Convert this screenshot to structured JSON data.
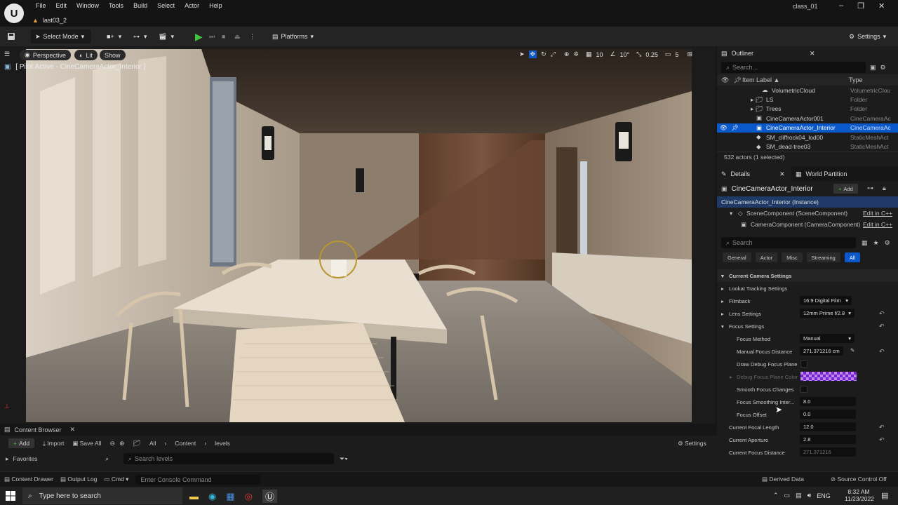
{
  "menubar": {
    "items": [
      "File",
      "Edit",
      "Window",
      "Tools",
      "Build",
      "Select",
      "Actor",
      "Help"
    ],
    "level_tab": "last03_2",
    "project": "class_01"
  },
  "toolbar": {
    "select_mode": "Select Mode",
    "platforms": "Platforms",
    "settings": "Settings"
  },
  "viewport": {
    "perspective": "Perspective",
    "lit": "Lit",
    "show": "Show",
    "pilot_label": "[ Pilot Active - CineCameraActor_Interior ]",
    "grid_value": "10",
    "angle_value": "10°",
    "scale_value": "0.25",
    "speed_value": "5"
  },
  "outliner": {
    "title": "Outliner",
    "search_placeholder": "Search...",
    "col_label": "Item Label ▲",
    "col_type": "Type",
    "rows": [
      {
        "name": "VolumetricCloud",
        "type": "VolumetricClou"
      },
      {
        "name": "LS",
        "type": "Folder"
      },
      {
        "name": "Trees",
        "type": "Folder"
      },
      {
        "name": "CineCameraActor001",
        "type": "CineCameraAc"
      },
      {
        "name": "CineCameraActor_Interior",
        "type": "CineCameraAc"
      },
      {
        "name": "SM_cliffrock04_lod00",
        "type": "StaticMeshAct"
      },
      {
        "name": "SM_dead-tree03",
        "type": "StaticMeshAct"
      }
    ],
    "count": "532 actors (1 selected)"
  },
  "details": {
    "tab": "Details",
    "tab2": "World Partition",
    "actor_name": "CineCameraActor_Interior",
    "add": "Add",
    "instance": "CineCameraActor_Interior (Instance)",
    "scene_component": "SceneComponent (SceneComponent)",
    "camera_component": "CameraComponent (CameraComponent)",
    "edit_cpp": "Edit in C++",
    "search_placeholder": "Search",
    "filters": [
      "General",
      "Actor",
      "Misc",
      "Streaming",
      "All"
    ],
    "section": "Current Camera Settings",
    "props": {
      "lookat": "Lookat Tracking Settings",
      "filmback": "Filmback",
      "filmback_val": "16:9 Digital Film",
      "lens": "Lens Settings",
      "lens_val": "12mm Prime f/2.8",
      "focus": "Focus Settings",
      "focus_method": "Focus Method",
      "focus_method_val": "Manual",
      "manual_focus": "Manual Focus Distance",
      "manual_focus_val": "271.371216 cm",
      "draw_debug": "Draw Debug Focus Plane",
      "debug_color": "Debug Focus Plane Color",
      "smooth": "Smooth Focus Changes",
      "smoothing_interp": "Focus Smoothing Inter...",
      "smoothing_interp_val": "8.0",
      "focus_offset": "Focus Offset",
      "focus_offset_val": "0.0",
      "focal_length": "Current Focal Length",
      "focal_length_val": "12.0",
      "aperture": "Current Aperture",
      "aperture_val": "2.8",
      "focus_distance": "Current Focus Distance",
      "focus_distance_val": "271.371216"
    },
    "debug_color_hex": "#7a1fd6"
  },
  "content_browser": {
    "title": "Content Browser",
    "add": "Add",
    "import": "Import",
    "save_all": "Save All",
    "path": [
      "All",
      "Content",
      "levels"
    ],
    "settings": "Settings",
    "favorites": "Favorites",
    "search_placeholder": "Search levels"
  },
  "statusbar": {
    "content_drawer": "Content Drawer",
    "output_log": "Output Log",
    "cmd": "Cmd",
    "console_placeholder": "Enter Console Command",
    "derived_data": "Derived Data",
    "source_control": "Source Control Off"
  },
  "taskbar": {
    "search_placeholder": "Type here to search",
    "lang": "ENG",
    "time": "8:32 AM",
    "date": "11/23/2022"
  }
}
